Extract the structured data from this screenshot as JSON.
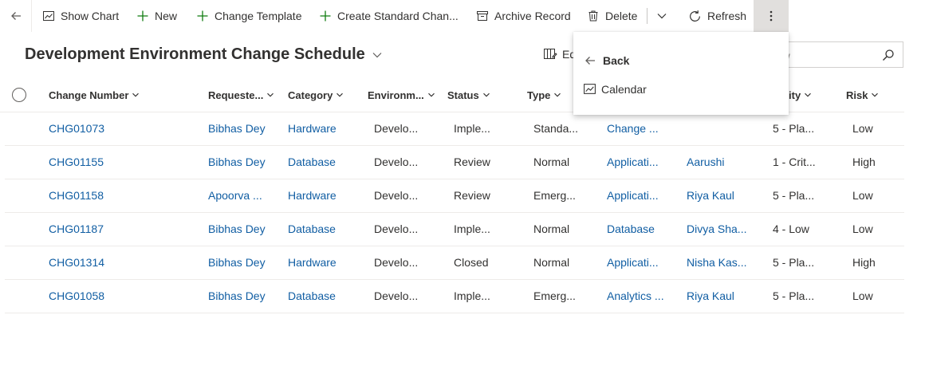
{
  "toolbar": {
    "show_chart": "Show Chart",
    "new": "New",
    "change_template": "Change Template",
    "create_standard_change": "Create Standard Chan...",
    "archive_record": "Archive Record",
    "delete": "Delete",
    "refresh": "Refresh"
  },
  "header": {
    "title": "Development Environment Change Schedule",
    "edit_columns_label": "Ed",
    "search_placeholder": "his view"
  },
  "menu": {
    "back": "Back",
    "items": [
      {
        "label": "Calendar",
        "icon": "calendar-icon"
      }
    ]
  },
  "columns": [
    "Change Number",
    "Requeste...",
    "Category",
    "Environm...",
    "Status",
    "Type",
    "ity",
    "Risk"
  ],
  "rows": [
    {
      "change_number": "CHG01073",
      "requester": "Bibhas Dey",
      "category": "Hardware",
      "environment": "Develo...",
      "status": "Imple...",
      "type": "Standa...",
      "service": "Change ...",
      "assigned": "",
      "priority": "5 - Pla...",
      "risk": "Low"
    },
    {
      "change_number": "CHG01155",
      "requester": "Bibhas Dey",
      "category": "Database",
      "environment": "Develo...",
      "status": "Review",
      "type": "Normal",
      "service": "Applicati...",
      "assigned": "Aarushi",
      "priority": "1 - Crit...",
      "risk": "High"
    },
    {
      "change_number": "CHG01158",
      "requester": "Apoorva ...",
      "category": "Hardware",
      "environment": "Develo...",
      "status": "Review",
      "type": "Emerg...",
      "service": "Applicati...",
      "assigned": "Riya Kaul",
      "priority": "5 - Pla...",
      "risk": "Low"
    },
    {
      "change_number": "CHG01187",
      "requester": "Bibhas Dey",
      "category": "Database",
      "environment": "Develo...",
      "status": "Imple...",
      "type": "Normal",
      "service": "Database",
      "assigned": "Divya Sha...",
      "priority": "4 - Low",
      "risk": "Low"
    },
    {
      "change_number": "CHG01314",
      "requester": "Bibhas Dey",
      "category": "Hardware",
      "environment": "Develo...",
      "status": "Closed",
      "type": "Normal",
      "service": "Applicati...",
      "assigned": "Nisha Kas...",
      "priority": "5 - Pla...",
      "risk": "High"
    },
    {
      "change_number": "CHG01058",
      "requester": "Bibhas Dey",
      "category": "Database",
      "environment": "Develo...",
      "status": "Imple...",
      "type": "Emerg...",
      "service": "Analytics ...",
      "assigned": "Riya Kaul",
      "priority": "5 - Pla...",
      "risk": "Low"
    }
  ],
  "colors": {
    "link": "#115ea3",
    "text": "#323130",
    "accent_green": "#107c10",
    "border": "#edebe9"
  }
}
